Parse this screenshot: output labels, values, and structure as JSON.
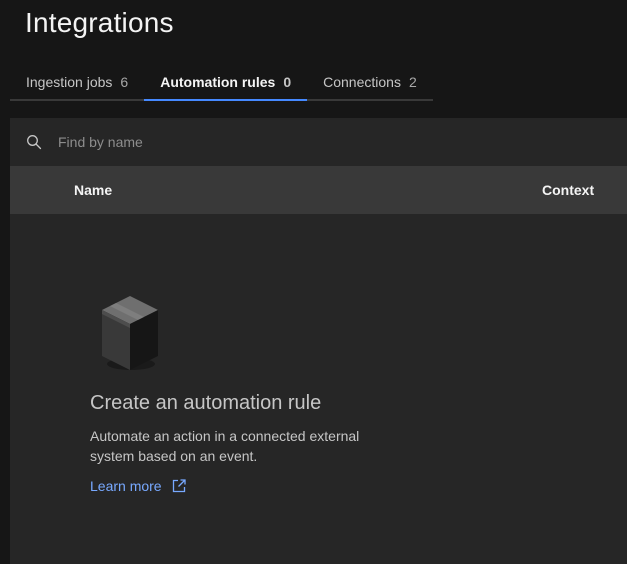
{
  "page": {
    "title": "Integrations"
  },
  "tabs": [
    {
      "label": "Ingestion jobs",
      "count": "6"
    },
    {
      "label": "Automation rules",
      "count": "0"
    },
    {
      "label": "Connections",
      "count": "2"
    }
  ],
  "search": {
    "placeholder": "Find by name"
  },
  "table": {
    "columns": [
      "Name",
      "Context"
    ]
  },
  "empty_state": {
    "title": "Create an automation rule",
    "description": "Automate an action in a connected external system based on an event.",
    "link_label": "Learn more"
  },
  "colors": {
    "accent": "#4589ff",
    "link": "#78a9ff",
    "background": "#161616",
    "panel": "#262626"
  }
}
